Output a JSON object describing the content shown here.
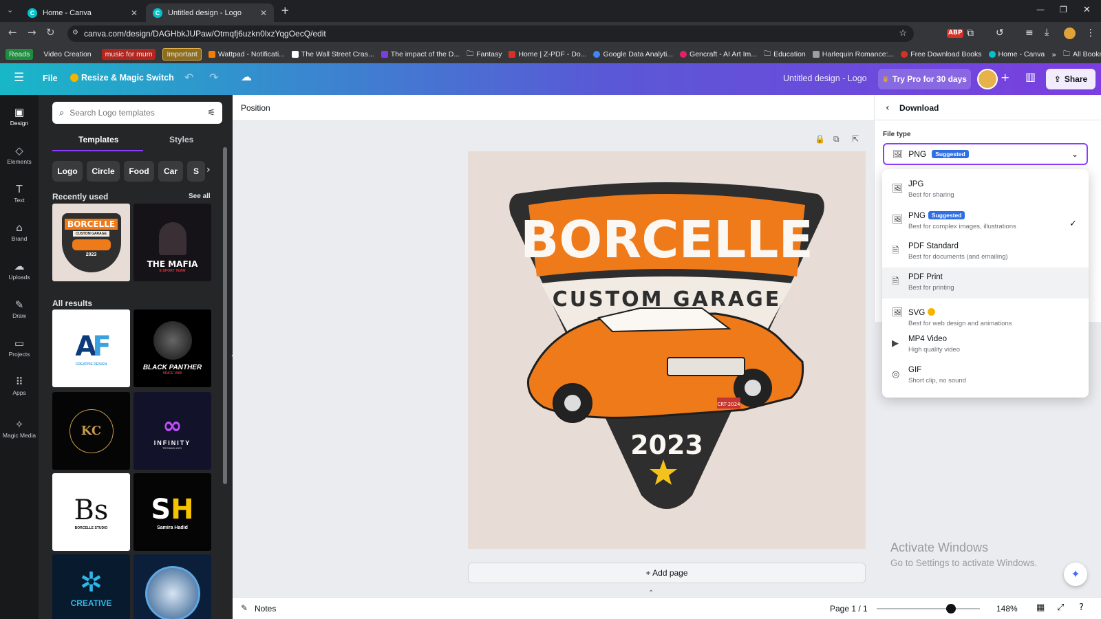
{
  "browser": {
    "tabs": [
      {
        "title": "Home - Canva"
      },
      {
        "title": "Untitled design - Logo"
      }
    ],
    "url": "canva.com/design/DAGHbkJUPaw/Otmqfj6uzkn0lxzYqgOecQ/edit",
    "bookmarks": [
      "Reads",
      "Video Creation",
      "music for mum",
      "Important",
      "Wattpad - Notificati...",
      "The Wall Street Cras...",
      "The impact of the D...",
      "Fantasy",
      "Home | Z-PDF - Do...",
      "Google Data Analyti...",
      "Gencraft - AI Art Im...",
      "Education",
      "Harlequin Romance:...",
      "Free Download Books",
      "Home - Canva",
      "All Bookmarks"
    ]
  },
  "header": {
    "file": "File",
    "resize": "Resize & Magic Switch",
    "doc_title": "Untitled design - Logo",
    "try_pro": "Try Pro for 30 days",
    "share": "Share"
  },
  "rail": [
    "Design",
    "Elements",
    "Text",
    "Brand",
    "Uploads",
    "Draw",
    "Projects",
    "Apps",
    "Magic Media"
  ],
  "panel": {
    "search_placeholder": "Search Logo templates",
    "tabs": [
      "Templates",
      "Styles"
    ],
    "chips": [
      "Logo",
      "Circle",
      "Food",
      "Car",
      "S"
    ],
    "recent_title": "Recently used",
    "see_all": "See all",
    "results_title": "All results",
    "thumbs": {
      "borcelle_top": "BORCELLE",
      "borcelle_sub": "CUSTOM GARAGE",
      "borcelle_year": "2023",
      "mafia": "THE MAFIA",
      "mafia_sub": "E-SPORT TEAM",
      "af_sub": "CREATIVE DESIGN",
      "panther": "BLACK PANTHER",
      "panther_sub": "SINCE 1980",
      "infinity": "INFINITY",
      "infinity_sub": "TECHNOLOGY",
      "borcelle_studio": "BORCELLE STUDIO",
      "samira": "Samira Hadid",
      "creative": "CREATIVE"
    }
  },
  "workspace": {
    "position": "Position",
    "design": {
      "top": "BORCELLE",
      "middle": "CUSTOM GARAGE",
      "year": "2023",
      "plate": "CRT-2024"
    },
    "add_page": "+ Add page",
    "notes": "Notes",
    "page": "Page 1 / 1",
    "zoom": "148%",
    "zoom_level": 0.72
  },
  "download": {
    "title": "Download",
    "file_type_label": "File type",
    "selected": "PNG",
    "suggested": "Suggested",
    "options": [
      {
        "name": "JPG",
        "desc": "Best for sharing",
        "icon": "image-icon"
      },
      {
        "name": "PNG",
        "desc": "Best for complex images, illustrations",
        "icon": "image-icon",
        "badge": "Suggested"
      },
      {
        "name": "PDF Standard",
        "desc": "Best for documents (and emailing)",
        "icon": "document-icon"
      },
      {
        "name": "PDF Print",
        "desc": "Best for printing",
        "icon": "document-icon"
      },
      {
        "name": "SVG",
        "desc": "Best for web design and animations",
        "icon": "image-icon"
      },
      {
        "name": "MP4 Video",
        "desc": "High quality video",
        "icon": "video-icon"
      },
      {
        "name": "GIF",
        "desc": "Short clip, no sound",
        "icon": "gif-icon"
      }
    ]
  },
  "watermark": {
    "line1": "Activate Windows",
    "line2": "Go to Settings to activate Windows."
  },
  "colors": {
    "accent": "#8b3dff",
    "orange": "#ef7a1a",
    "badge": "#2f6fe4"
  }
}
